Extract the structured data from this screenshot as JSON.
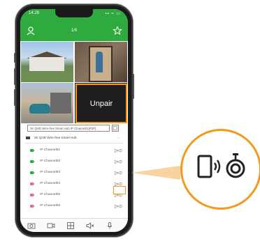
{
  "status": {
    "time": "14:28",
    "icons": "▪▪ ≈ ▭"
  },
  "header": {
    "page": "1/6"
  },
  "grid": {
    "unpair_label": "Unpair"
  },
  "hub": {
    "bar_text": "2K QHD Wire-free Smart Hub IP Channel01[P2P]",
    "group_label": "2K QHD Wire-free Smart Hub"
  },
  "channels": [
    {
      "label": "IP Channel01",
      "color": "#2faa3f"
    },
    {
      "label": "IP Channel02",
      "color": "#2faa3f"
    },
    {
      "label": "IP Channel03",
      "color": "#2faa3f"
    },
    {
      "label": "IP Channel04",
      "color": "#e0708a"
    },
    {
      "label": "IP Channel05",
      "color": "#e0708a"
    },
    {
      "label": "IP Channel06",
      "color": "#e0708a"
    }
  ],
  "pair_symbol": "▯»⊙",
  "accent": "#f39a1e",
  "brand_green": "#2faa3f"
}
